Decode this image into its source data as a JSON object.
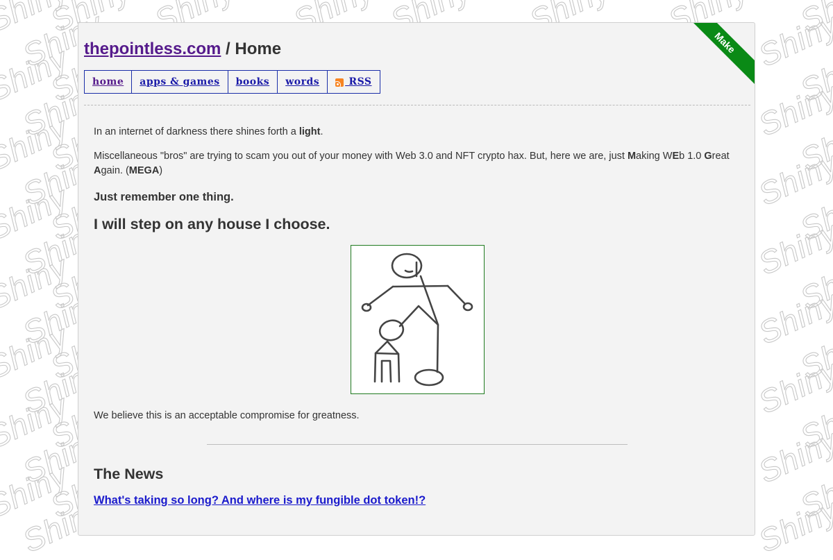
{
  "background": {
    "watermark_text": "Shiny",
    "watermark_color": "#c8c8c8"
  },
  "ribbon": {
    "label": "Make",
    "color": "#0a8a16"
  },
  "header": {
    "site_name": "thepointless.com",
    "separator": " / ",
    "page_name": "Home"
  },
  "nav": {
    "items": [
      {
        "label": "home",
        "active": true
      },
      {
        "label": "apps & games",
        "active": false
      },
      {
        "label": "books",
        "active": false
      },
      {
        "label": "words",
        "active": false
      },
      {
        "label": " RSS",
        "icon": "rss-icon",
        "active": false
      }
    ]
  },
  "content": {
    "p1_text": "In an internet of darkness there shines forth a ",
    "p1_bold": "light",
    "p1_end": ".",
    "p2_a": "Miscellaneous \"bros\" are trying to scam you out of your money with Web 3.0 and NFT crypto hax. But, here we are, just ",
    "p2_M": "M",
    "p2_b": "aking W",
    "p2_E": "E",
    "p2_c": "b 1.0 ",
    "p2_G": "G",
    "p2_d": "reat",
    "p2_A": "A",
    "p2_e": "gain. (",
    "p2_mega": "MEGA",
    "p2_f": ")",
    "remember": "Just remember one thing.",
    "step": "I will step on any house I choose.",
    "drawing_alt": "stick figure stepping on a house",
    "p3": "We believe this is an acceptable compromise for greatness."
  },
  "news": {
    "heading": "The News",
    "link_text": "What's taking so long? And where is my fungible dot token!?"
  }
}
